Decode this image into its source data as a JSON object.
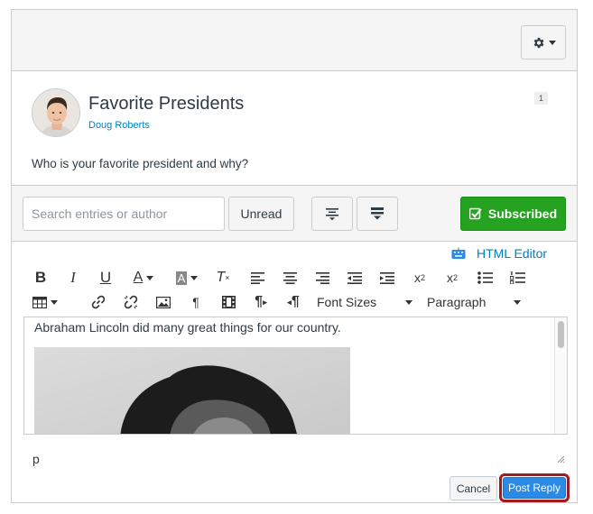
{
  "topbar": {
    "settings_icon": "gear-icon",
    "dropdown_icon": "caret-down-icon"
  },
  "post": {
    "title": "Favorite Presidents",
    "author": "Doug Roberts",
    "unread_count": "1",
    "body": "Who is your favorite president and why?",
    "avatar_icon": "user-avatar"
  },
  "filters": {
    "search_placeholder": "Search entries or author",
    "unread_label": "Unread",
    "expand_icon": "expand-threads-icon",
    "collapse_icon": "collapse-threads-icon",
    "subscribed_label": "Subscribed",
    "subscribed_icon": "checkbox-icon"
  },
  "editor": {
    "html_editor_label": "HTML Editor",
    "keyboard_icon": "keyboard-icon",
    "toolbar_row1": [
      "bold-icon",
      "italic-icon",
      "underline-icon",
      "text-color-icon",
      "background-color-icon",
      "clear-formatting-icon",
      "align-left-icon",
      "align-center-icon",
      "align-right-icon",
      "outdent-icon",
      "indent-icon",
      "superscript-icon",
      "subscript-icon",
      "bullet-list-icon",
      "numbered-list-icon"
    ],
    "toolbar_row2": [
      "table-icon",
      "link-icon",
      "unlink-icon",
      "image-icon",
      "paragraph-icon",
      "media-icon",
      "ltr-icon",
      "rtl-icon"
    ],
    "font_sizes_label": "Font Sizes",
    "paragraph_label": "Paragraph",
    "content_text": "Abraham Lincoln did many great things for our country.",
    "path_label": "p"
  },
  "actions": {
    "cancel_label": "Cancel",
    "post_reply_label": "Post Reply"
  },
  "colors": {
    "subscribed": "#24a220",
    "primary": "#2a8ae6",
    "link": "#0081bd",
    "highlight_outline": "#a2191e"
  }
}
